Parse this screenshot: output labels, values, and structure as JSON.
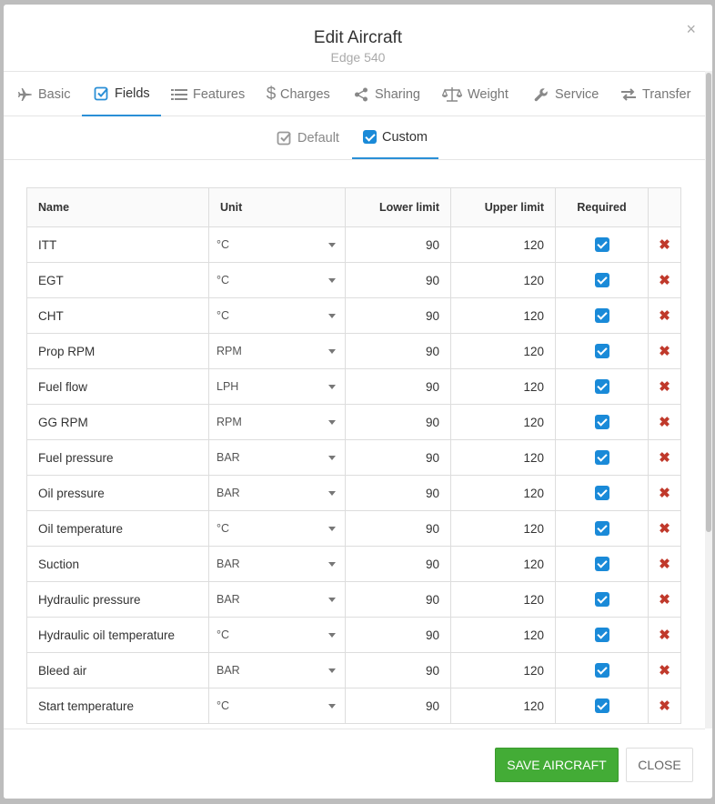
{
  "modal": {
    "title": "Edit Aircraft",
    "subtitle": "Edge 540",
    "close_icon": "×"
  },
  "tabs": [
    {
      "label": "Basic",
      "icon": "plane-icon",
      "active": false
    },
    {
      "label": "Fields",
      "icon": "checkbox-icon",
      "active": true
    },
    {
      "label": "Features",
      "icon": "list-icon",
      "active": false
    },
    {
      "label": "Charges",
      "icon": "dollar-icon",
      "active": false
    },
    {
      "label": "Sharing",
      "icon": "share-icon",
      "active": false
    },
    {
      "label": "Weight",
      "icon": "scale-icon",
      "active": false
    },
    {
      "label": "Service",
      "icon": "wrench-icon",
      "active": false
    },
    {
      "label": "Transfer",
      "icon": "exchange-icon",
      "active": false
    }
  ],
  "subtabs": [
    {
      "label": "Default",
      "active": false
    },
    {
      "label": "Custom",
      "active": true
    }
  ],
  "table": {
    "headers": {
      "name": "Name",
      "unit": "Unit",
      "lower": "Lower limit",
      "upper": "Upper limit",
      "required": "Required"
    },
    "rows": [
      {
        "name": "ITT",
        "unit": "°C",
        "lower": "90",
        "upper": "120",
        "required": true
      },
      {
        "name": "EGT",
        "unit": "°C",
        "lower": "90",
        "upper": "120",
        "required": true
      },
      {
        "name": "CHT",
        "unit": "°C",
        "lower": "90",
        "upper": "120",
        "required": true
      },
      {
        "name": "Prop RPM",
        "unit": "RPM",
        "lower": "90",
        "upper": "120",
        "required": true
      },
      {
        "name": "Fuel flow",
        "unit": "LPH",
        "lower": "90",
        "upper": "120",
        "required": true
      },
      {
        "name": "GG RPM",
        "unit": "RPM",
        "lower": "90",
        "upper": "120",
        "required": true
      },
      {
        "name": "Fuel pressure",
        "unit": "BAR",
        "lower": "90",
        "upper": "120",
        "required": true
      },
      {
        "name": "Oil pressure",
        "unit": "BAR",
        "lower": "90",
        "upper": "120",
        "required": true
      },
      {
        "name": "Oil temperature",
        "unit": "°C",
        "lower": "90",
        "upper": "120",
        "required": true
      },
      {
        "name": "Suction",
        "unit": "BAR",
        "lower": "90",
        "upper": "120",
        "required": true
      },
      {
        "name": "Hydraulic pressure",
        "unit": "BAR",
        "lower": "90",
        "upper": "120",
        "required": true
      },
      {
        "name": "Hydraulic oil temperature",
        "unit": "°C",
        "lower": "90",
        "upper": "120",
        "required": true
      },
      {
        "name": "Bleed air",
        "unit": "BAR",
        "lower": "90",
        "upper": "120",
        "required": true
      },
      {
        "name": "Start temperature",
        "unit": "°C",
        "lower": "90",
        "upper": "120",
        "required": true
      }
    ],
    "delete_icon": "✖"
  },
  "footer": {
    "save_label": "SAVE AIRCRAFT",
    "close_label": "CLOSE"
  },
  "colors": {
    "accent": "#2a8fd6",
    "checkbox": "#1a8ad8",
    "delete": "#c0392b",
    "save": "#43ac36"
  }
}
